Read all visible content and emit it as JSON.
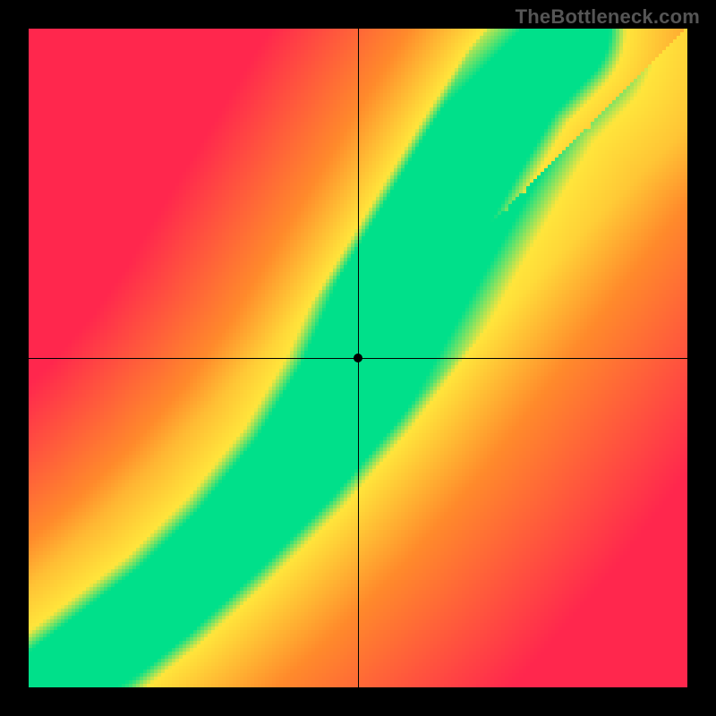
{
  "watermark": "TheBottleneck.com",
  "chart_data": {
    "type": "heatmap",
    "title": "",
    "xlabel": "",
    "ylabel": "",
    "x_range": [
      0,
      1
    ],
    "y_range": [
      0,
      1
    ],
    "grid_resolution": 184,
    "crosshair": {
      "x": 0.5,
      "y": 0.5
    },
    "diagonal_path": [
      {
        "x": 0.0,
        "y": 0.0,
        "half_width": 0.005
      },
      {
        "x": 0.1,
        "y": 0.07,
        "half_width": 0.01
      },
      {
        "x": 0.2,
        "y": 0.14,
        "half_width": 0.015
      },
      {
        "x": 0.3,
        "y": 0.23,
        "half_width": 0.02
      },
      {
        "x": 0.4,
        "y": 0.34,
        "half_width": 0.028
      },
      {
        "x": 0.48,
        "y": 0.46,
        "half_width": 0.035
      },
      {
        "x": 0.54,
        "y": 0.58,
        "half_width": 0.042
      },
      {
        "x": 0.6,
        "y": 0.7,
        "half_width": 0.048
      },
      {
        "x": 0.66,
        "y": 0.82,
        "half_width": 0.055
      },
      {
        "x": 0.72,
        "y": 0.93,
        "half_width": 0.06
      },
      {
        "x": 0.78,
        "y": 1.0,
        "half_width": 0.065
      }
    ],
    "colors": {
      "green": "#00e08a",
      "yellow": "#ffe53b",
      "orange": "#ff8a2b",
      "red": "#ff274d"
    },
    "color_stops": [
      {
        "dist": 0.0,
        "color": "green"
      },
      {
        "dist": 0.06,
        "color": "green"
      },
      {
        "dist": 0.1,
        "color": "yellow"
      },
      {
        "dist": 0.32,
        "color": "orange"
      },
      {
        "dist": 0.75,
        "color": "red"
      }
    ]
  }
}
